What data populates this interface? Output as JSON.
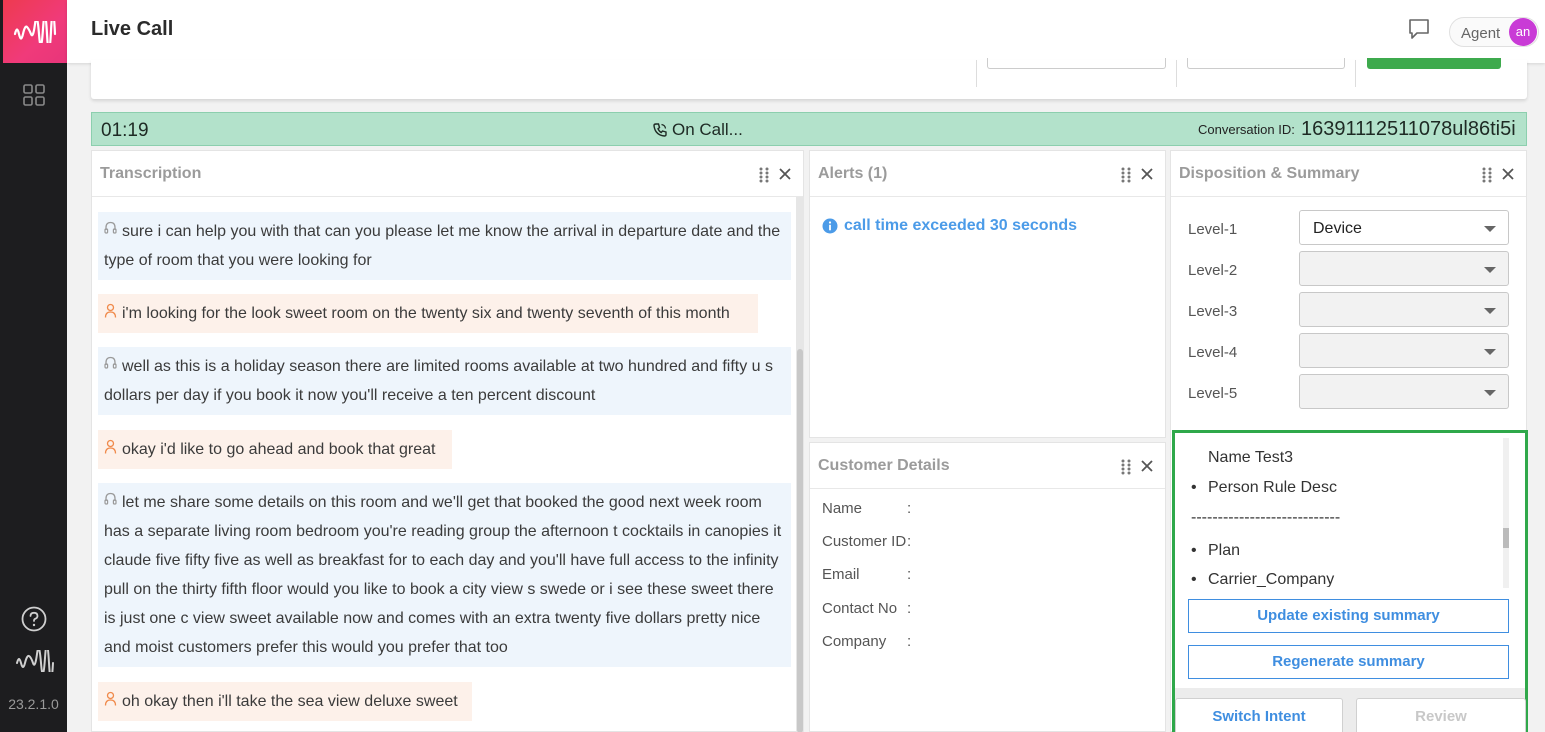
{
  "app": {
    "title": "Live Call",
    "version": "23.2.1.0",
    "agent_label": "Agent",
    "avatar_initials": "an",
    "brand_color": "#ee3a4f"
  },
  "call": {
    "timer": "01:19",
    "status": "On Call...",
    "conversation_id_label": "Conversation ID:",
    "conversation_id": "16391112511078ul86ti5i"
  },
  "transcription": {
    "title": "Transcription",
    "messages": [
      {
        "speaker": "agent",
        "icon": "headset-icon",
        "text": "sure i can help you with that can you please let me know the arrival in departure date and the type of room that you were looking for"
      },
      {
        "speaker": "customer",
        "icon": "person-icon",
        "text": "i'm looking for the look sweet room on the twenty six and twenty seventh of this month"
      },
      {
        "speaker": "agent",
        "icon": "headset-icon",
        "text": "well as this is a holiday season there are limited rooms available at two hundred and fifty u s dollars per day if you book it now you'll receive a ten percent discount"
      },
      {
        "speaker": "customer",
        "icon": "person-icon",
        "text": "okay i'd like to go ahead and book that great"
      },
      {
        "speaker": "agent",
        "icon": "headset-icon",
        "text": "let me share some details on this room and we'll get that booked the good next week room has a separate living room bedroom you're reading group the afternoon t cocktails in canopies it claude five fifty five as well as breakfast for to each day and you'll have full access to the infinity pull on the thirty fifth floor would you like to book a city view s swede or i see these sweet there is just one c view sweet available now and comes with an extra twenty five dollars pretty nice and moist customers prefer this would you prefer that too"
      },
      {
        "speaker": "customer",
        "icon": "person-icon",
        "text": "oh okay then i'll take the sea view deluxe sweet"
      }
    ]
  },
  "alerts": {
    "title": "Alerts (1)",
    "items": [
      "call time exceeded 30 seconds"
    ]
  },
  "customer": {
    "title": "Customer Details",
    "fields": [
      {
        "label": "Name",
        "value": ""
      },
      {
        "label": "Customer ID",
        "value": ""
      },
      {
        "label": "Email",
        "value": ""
      },
      {
        "label": "Contact No",
        "value": ""
      },
      {
        "label": "Company",
        "value": ""
      }
    ]
  },
  "disposition": {
    "title": "Disposition & Summary",
    "levels": [
      {
        "label": "Level-1",
        "value": "Device"
      },
      {
        "label": "Level-2",
        "value": ""
      },
      {
        "label": "Level-3",
        "value": ""
      },
      {
        "label": "Level-4",
        "value": ""
      },
      {
        "label": "Level-5",
        "value": ""
      }
    ],
    "summary_lines": [
      "Name Test3",
      "Person Rule Desc",
      "----------------------------",
      "Plan",
      "Carrier_Company"
    ],
    "update_button": "Update existing summary",
    "regenerate_button": "Regenerate summary",
    "switch_intent_button": "Switch Intent",
    "review_button": "Review"
  }
}
